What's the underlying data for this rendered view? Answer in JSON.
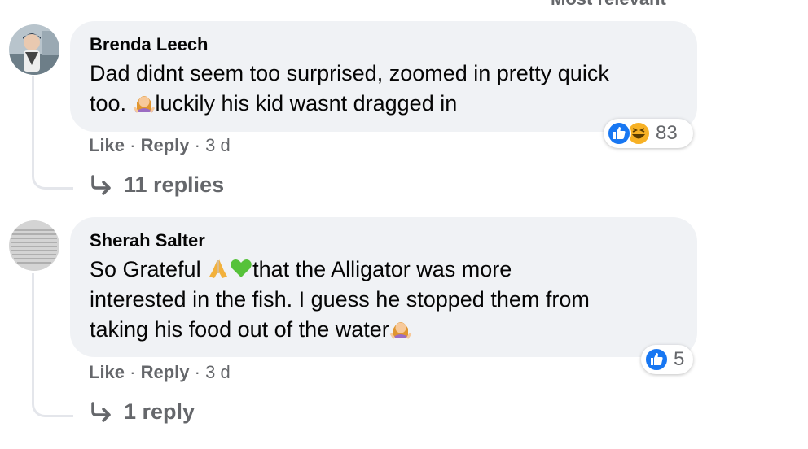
{
  "header": {
    "sort_label_partial": "Most relevant"
  },
  "comments": [
    {
      "author": "Brenda Leech",
      "line1": "Dad didnt seem too surprised, zoomed in pretty quick",
      "line2_before": "too. ",
      "line2_after": "luckily his kid wasnt dragged in",
      "reactions": {
        "icons": [
          "like-icon",
          "haha-icon"
        ],
        "count": "83"
      },
      "actions": {
        "like": "Like",
        "reply": "Reply",
        "time": "3 d",
        "sep": "·"
      },
      "replies_label": "11 replies"
    },
    {
      "author": "Sherah Salter",
      "line1_before": "So Grateful ",
      "line1_after": "that the Alligator was more",
      "line2": "interested in the fish. I guess he stopped them from",
      "line3": "taking his food out of the water",
      "reactions": {
        "icons": [
          "like-icon"
        ],
        "count": "5"
      },
      "actions": {
        "like": "Like",
        "reply": "Reply",
        "time": "3 d",
        "sep": "·"
      },
      "replies_label": "1 reply"
    }
  ],
  "colors": {
    "bubble": "#f0f2f5",
    "muted": "#65676b",
    "like_blue": "#1877f2",
    "haha_yellow": "#f7b125"
  }
}
